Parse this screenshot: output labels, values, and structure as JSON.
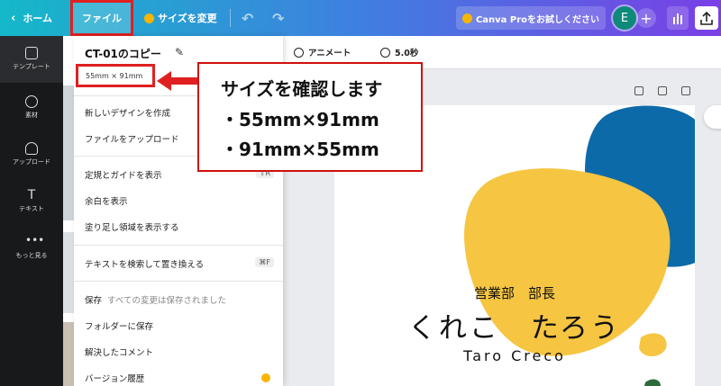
{
  "topbar": {
    "home_label": "ホーム",
    "file_label": "ファイル",
    "resize_label": "サイズを変更",
    "trial_label": "Canva Proをお試しください",
    "avatar_initial": "E",
    "accent_colors": [
      "#15b8c9",
      "#7a3fe6"
    ]
  },
  "sidebar": {
    "items": [
      {
        "label": "テンプレート",
        "icon": "template-icon"
      },
      {
        "label": "素材",
        "icon": "elements-icon"
      },
      {
        "label": "アップロード",
        "icon": "upload-icon"
      },
      {
        "label": "テキスト",
        "icon": "text-icon"
      },
      {
        "label": "もっと見る",
        "icon": "more-icon"
      }
    ]
  },
  "file_menu": {
    "title": "CT-01のコピー",
    "size": "55mm × 91mm",
    "items": [
      {
        "label": "新しいデザインを作成"
      },
      {
        "label": "ファイルをアップロード"
      },
      {
        "label": "定規とガイドを表示",
        "shortcut": "⇧R"
      },
      {
        "label": "余白を表示"
      },
      {
        "label": "塗り足し領域を表示する"
      },
      {
        "label": "テキストを検索して置き換える",
        "shortcut": "⌘F"
      },
      {
        "label": "保存",
        "sub": "すべての変更は保存されました"
      },
      {
        "label": "フォルダーに保存"
      },
      {
        "label": "解決したコメント"
      },
      {
        "label": "バージョン履歴"
      }
    ]
  },
  "toolbar": {
    "animate_label": "アニメート",
    "duration_label": "5.0秒"
  },
  "callout": {
    "line1": "サイズを確認します",
    "line2": "・55mm×91mm",
    "line3": "・91mm×55mm"
  },
  "card": {
    "department": "営業部　部長",
    "name": "くれこ　たろう",
    "romaji": "Taro Creco",
    "colors": {
      "yellow": "#f6c542",
      "blue": "#0d6aa8",
      "green": "#2e6b3a"
    }
  }
}
